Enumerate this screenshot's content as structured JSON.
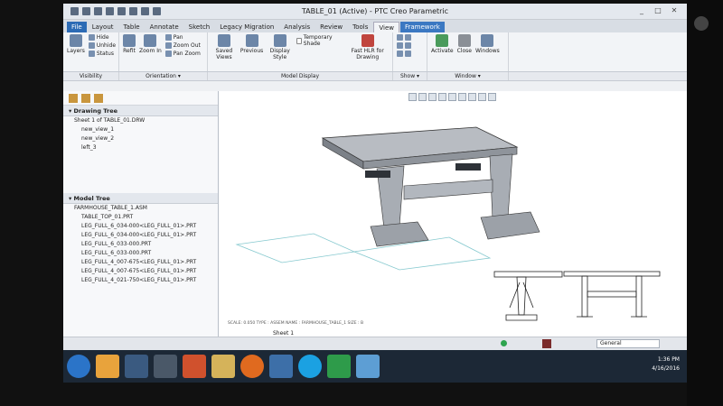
{
  "window": {
    "title": "TABLE_01 (Active) - PTC Creo Parametric"
  },
  "tabs": [
    {
      "label": "File",
      "style": "file"
    },
    {
      "label": "Layout",
      "style": ""
    },
    {
      "label": "Table",
      "style": ""
    },
    {
      "label": "Annotate",
      "style": ""
    },
    {
      "label": "Sketch",
      "style": ""
    },
    {
      "label": "Legacy Migration",
      "style": ""
    },
    {
      "label": "Analysis",
      "style": ""
    },
    {
      "label": "Review",
      "style": ""
    },
    {
      "label": "Tools",
      "style": ""
    },
    {
      "label": "View",
      "style": "active"
    },
    {
      "label": "Framework",
      "style": "framework"
    }
  ],
  "ribbon": {
    "layers": "Layers",
    "hide": "Hide",
    "unhide": "Unhide",
    "status": "Status",
    "refit": "Refit",
    "zoom_in": "Zoom In",
    "pan": "Pan",
    "zoom_out": "Zoom Out",
    "pan_zoom": "Pan Zoom",
    "saved_views": "Saved Views",
    "previous": "Previous",
    "display_style": "Display Style",
    "temporary_shade": "Temporary Shade",
    "fast_hlr": "Fast HLR for Drawing",
    "activate": "Activate",
    "close": "Close",
    "windows": "Windows"
  },
  "group_labels": {
    "visibility": "Visibility",
    "orientation": "Orientation ▾",
    "model_display": "Model Display",
    "show": "Show ▾",
    "window": "Window ▾"
  },
  "drawing_tree": {
    "header": "Drawing Tree",
    "items": [
      "Sheet 1 of TABLE_01.DRW",
      "new_view_1",
      "new_view_2",
      "left_3"
    ]
  },
  "model_tree": {
    "header": "Model Tree",
    "items": [
      "FARMHOUSE_TABLE_1.ASM",
      "TABLE_TOP_01.PRT",
      "LEG_FULL_6_034-000<LEG_FULL_01>.PRT",
      "LEG_FULL_6_034-000<LEG_FULL_01>.PRT",
      "LEG_FULL_6_033-000.PRT",
      "LEG_FULL_6_033-000.PRT",
      "LEG_FULL_4_007-675<LEG_FULL_01>.PRT",
      "LEG_FULL_4_007-675<LEG_FULL_01>.PRT",
      "LEG_FULL_4_021-750<LEG_FULL_01>.PRT"
    ]
  },
  "canvas": {
    "scale_line": "SCALE: 0.050    TYPE : ASSEM    NAME : FARMHOUSE_TABLE_1    SIZE : B",
    "sheet_tab": "Sheet 1"
  },
  "status": {
    "select": "General"
  },
  "clock": {
    "time": "1:36 PM",
    "date": "4/16/2016"
  },
  "colors": {
    "file_tab": "#2c6bb5",
    "framework_tab": "#3b78c2",
    "taskbar": "#1c2836"
  }
}
